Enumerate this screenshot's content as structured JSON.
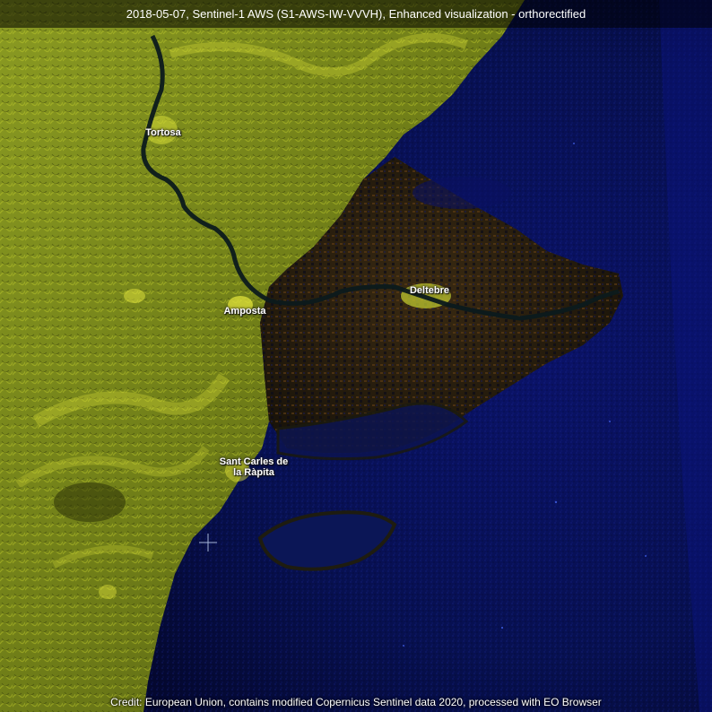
{
  "header": {
    "title": "2018-05-07, Sentinel-1 AWS (S1-AWS-IW-VVVH), Enhanced visualization - orthorectified"
  },
  "footer": {
    "credit": "Credit: European Union, contains modified Copernicus Sentinel data 2020, processed with EO Browser"
  },
  "places": {
    "tortosa": "Tortosa",
    "deltebre": "Deltebre",
    "amposta": "Amposta",
    "sant_carles_line1": "Sant Carles de",
    "sant_carles_line2": "la Ràpita"
  },
  "colors": {
    "sea": "#070b4a",
    "land": "#7a8a1e",
    "relief_highlight": "#c9d02a",
    "delta": "#2a1f10",
    "river": "#0f2a2a"
  }
}
